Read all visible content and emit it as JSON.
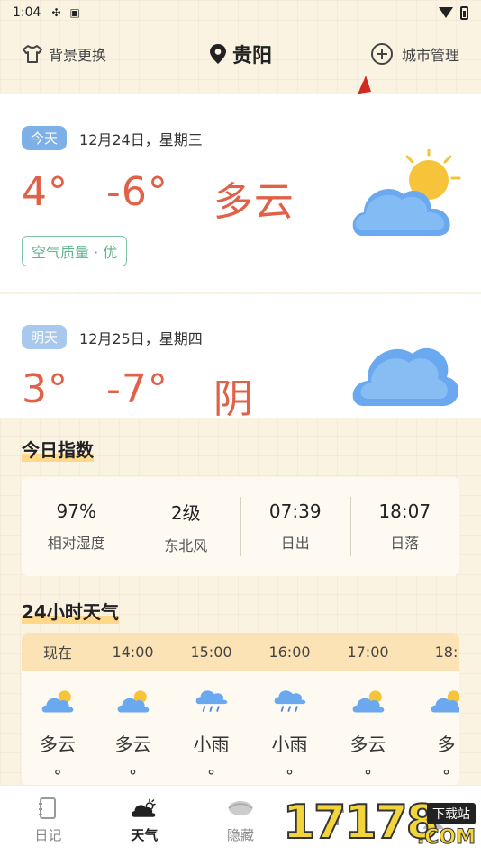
{
  "status_bar": {
    "time": "1:04"
  },
  "header": {
    "background_label": "背景更换",
    "city": "贵阳",
    "manage_label": "城市管理"
  },
  "today": {
    "badge": "今天",
    "date": "12月24日，星期三",
    "high": "4°",
    "low": "-6°",
    "condition": "多云",
    "aqi": "空气质量 · 优",
    "icon": "partly-cloudy-icon"
  },
  "tomorrow": {
    "badge": "明天",
    "date": "12月25日，星期四",
    "high": "3°",
    "low": "-7°",
    "condition": "阴",
    "icon": "cloudy-icon"
  },
  "indices": {
    "title": "今日指数",
    "items": [
      {
        "value": "97%",
        "label": "相对湿度"
      },
      {
        "value": "2级",
        "label": "东北风"
      },
      {
        "value": "07:39",
        "label": "日出"
      },
      {
        "value": "18:07",
        "label": "日落"
      }
    ]
  },
  "hourly": {
    "title": "24小时天气",
    "hours": [
      {
        "time": "现在",
        "condition": "多云",
        "icon": "partly-cloudy-icon",
        "temp": "°"
      },
      {
        "time": "14:00",
        "condition": "多云",
        "icon": "partly-cloudy-icon",
        "temp": "°"
      },
      {
        "time": "15:00",
        "condition": "小雨",
        "icon": "rain-icon",
        "temp": "°"
      },
      {
        "time": "16:00",
        "condition": "小雨",
        "icon": "rain-icon",
        "temp": "°"
      },
      {
        "time": "17:00",
        "condition": "多云",
        "icon": "partly-cloudy-icon",
        "temp": "°"
      },
      {
        "time": "18:",
        "condition": "多",
        "icon": "partly-cloudy-icon",
        "temp": "°"
      }
    ]
  },
  "tabs": [
    {
      "label": "日记",
      "icon": "notebook-icon",
      "active": false
    },
    {
      "label": "天气",
      "icon": "weather-icon",
      "active": true
    },
    {
      "label": "隐藏",
      "icon": "eye-icon",
      "active": false
    },
    {
      "label": "",
      "icon": "text-icon",
      "active": false
    },
    {
      "label": "",
      "icon": "user-icon",
      "active": false
    }
  ],
  "watermark": {
    "number": "17178",
    "badge": "下载站",
    "suffix": ".COM"
  },
  "colors": {
    "temp": "#e06048",
    "accent": "#7eb0e8",
    "aqi": "#5eb38c",
    "highlight": "#ffd88a"
  }
}
